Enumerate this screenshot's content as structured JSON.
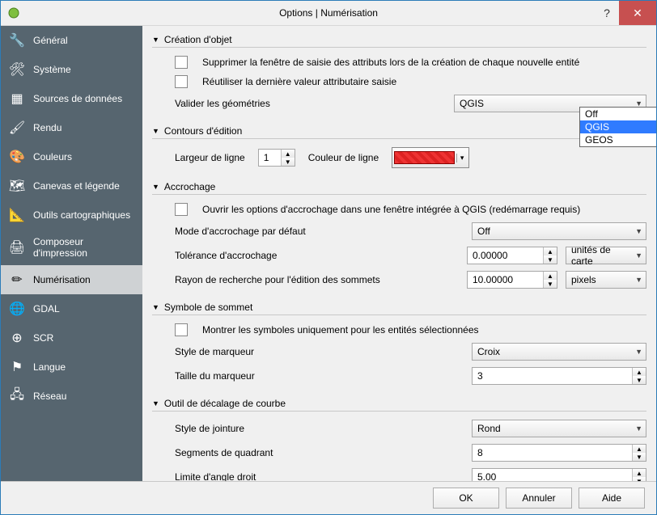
{
  "window": {
    "title": "Options | Numérisation"
  },
  "sidebar": {
    "items": [
      {
        "label": "Général",
        "icon": "🔧"
      },
      {
        "label": "Système",
        "icon": "🛠"
      },
      {
        "label": "Sources de données",
        "icon": "▦"
      },
      {
        "label": "Rendu",
        "icon": "🖌"
      },
      {
        "label": "Couleurs",
        "icon": "🎨"
      },
      {
        "label": "Canevas et légende",
        "icon": "🗺"
      },
      {
        "label": "Outils cartographiques",
        "icon": "📐"
      },
      {
        "label": "Composeur d'impression",
        "icon": "🖨"
      },
      {
        "label": "Numérisation",
        "icon": "✏"
      },
      {
        "label": "GDAL",
        "icon": "🌐"
      },
      {
        "label": "SCR",
        "icon": "⊕"
      },
      {
        "label": "Langue",
        "icon": "⚑"
      },
      {
        "label": "Réseau",
        "icon": "🖧"
      }
    ],
    "selected_index": 8
  },
  "sections": {
    "creation": {
      "title": "Création d'objet",
      "suppress_label": "Supprimer la fenêtre de saisie des attributs lors de la création de chaque nouvelle entité",
      "reuse_label": "Réutiliser la dernière valeur attributaire saisie",
      "validate_label": "Valider les géométries",
      "validate_value": "QGIS",
      "validate_options": [
        "Off",
        "QGIS",
        "GEOS"
      ],
      "validate_selected_option_index": 1
    },
    "contours": {
      "title": "Contours d'édition",
      "line_width_label": "Largeur de ligne",
      "line_width_value": "1",
      "line_color_label": "Couleur de ligne",
      "line_color": "#e03030"
    },
    "accrochage": {
      "title": "Accrochage",
      "open_label": "Ouvrir les options d'accrochage dans une fenêtre intégrée à QGIS (redémarrage requis)",
      "mode_label": "Mode d'accrochage par défaut",
      "mode_value": "Off",
      "tol_label": "Tolérance d'accrochage",
      "tol_value": "0.00000",
      "tol_unit": "unités de carte",
      "radius_label": "Rayon de recherche pour l'édition des sommets",
      "radius_value": "10.00000",
      "radius_unit": "pixels"
    },
    "symbole": {
      "title": "Symbole de sommet",
      "show_label": "Montrer les symboles uniquement pour les entités sélectionnées",
      "style_label": "Style de marqueur",
      "style_value": "Croix",
      "size_label": "Taille du marqueur",
      "size_value": "3"
    },
    "offset": {
      "title": "Outil de décalage de courbe",
      "join_label": "Style de jointure",
      "join_value": "Rond",
      "seg_label": "Segments de quadrant",
      "seg_value": "8",
      "angle_label": "Limite d'angle droit",
      "angle_value": "5.00"
    }
  },
  "buttons": {
    "ok": "OK",
    "cancel": "Annuler",
    "help": "Aide"
  }
}
